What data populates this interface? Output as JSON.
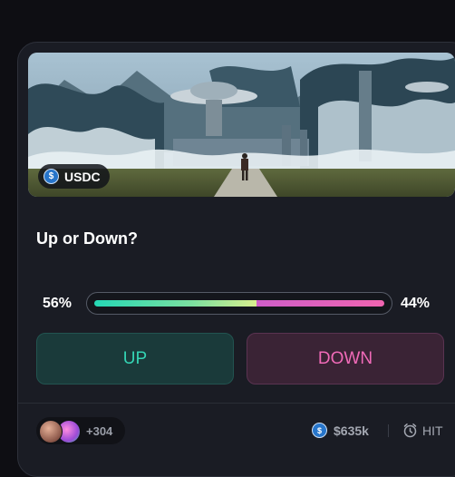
{
  "market": {
    "token": "USDC",
    "question": "Up or Down?",
    "up_percent_label": "56%",
    "down_percent_label": "44%",
    "up_fraction": 0.56,
    "up_button": "UP",
    "down_button": "DOWN"
  },
  "footer": {
    "participants_extra": "+304",
    "volume": "$635k",
    "timer_text": "HIT"
  },
  "colors": {
    "up_accent": "#34d4b4",
    "down_accent": "#f06ab8",
    "card_bg": "#1a1c24",
    "usdc_blue": "#2775ca"
  },
  "icons": [
    "usdc-icon",
    "alarm-clock-icon",
    "avatar"
  ]
}
